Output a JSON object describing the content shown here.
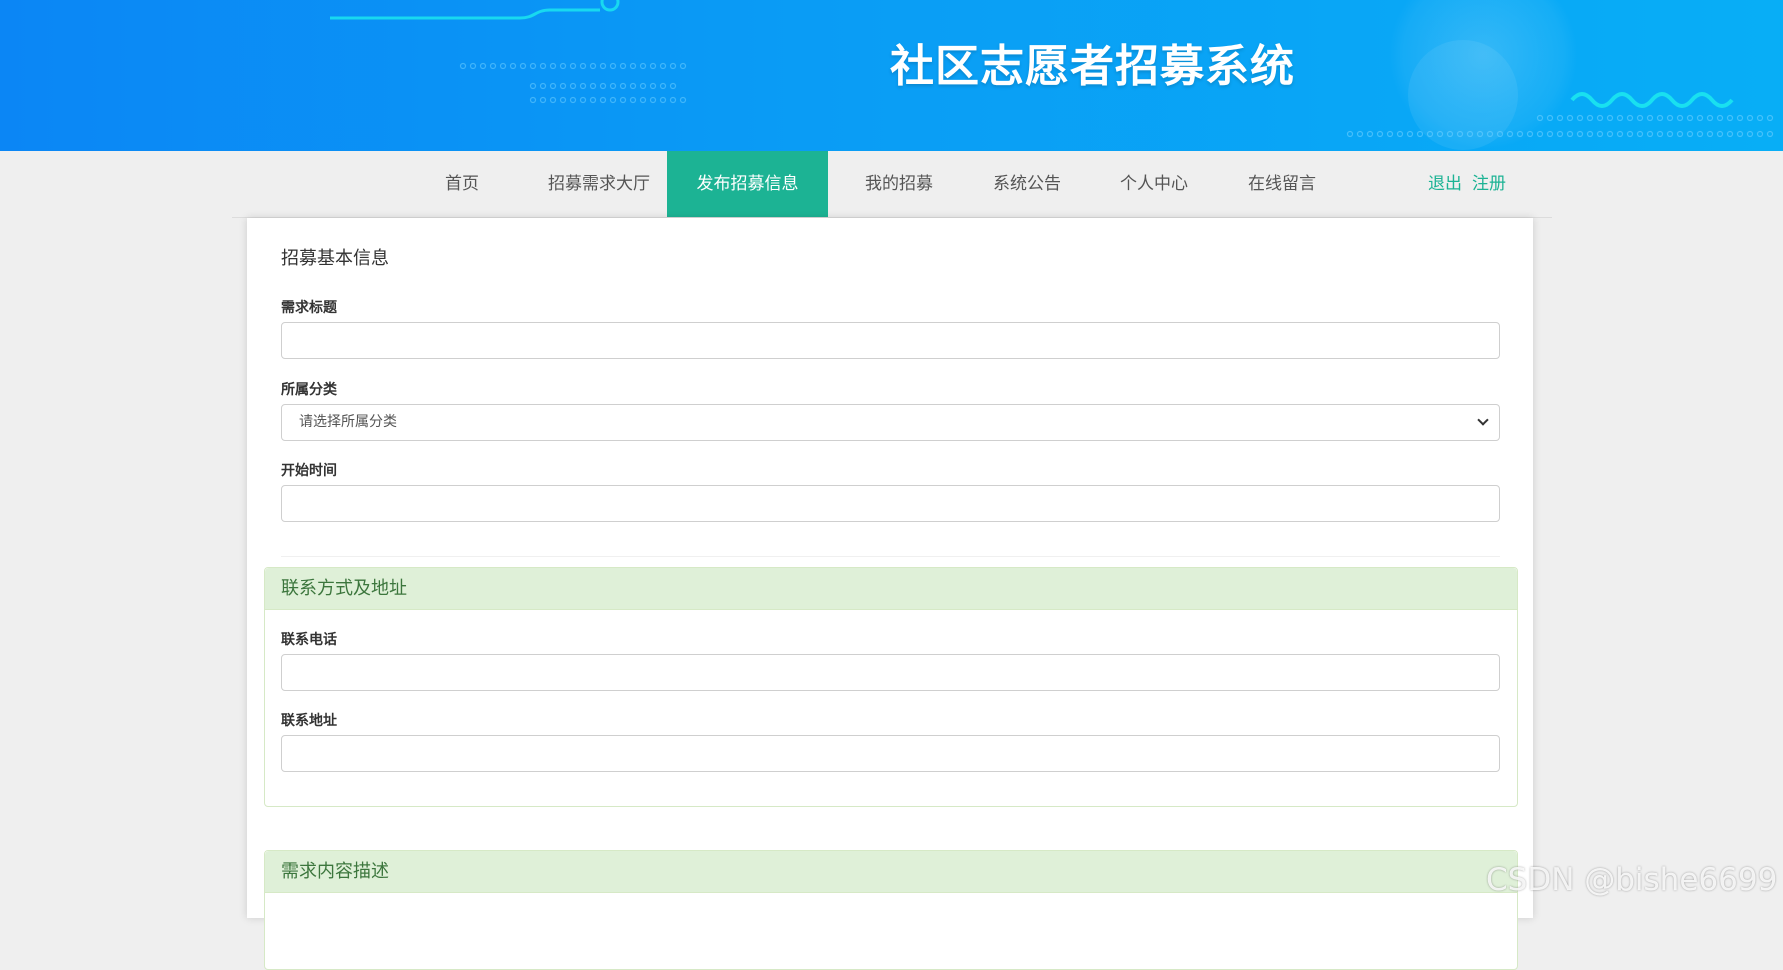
{
  "header": {
    "site_title": "社区志愿者招募系统"
  },
  "nav": {
    "items": [
      {
        "label": "首页",
        "active": false
      },
      {
        "label": "招募需求大厅",
        "active": false
      },
      {
        "label": "发布招募信息",
        "active": true
      },
      {
        "label": "我的招募",
        "active": false
      },
      {
        "label": "系统公告",
        "active": false
      },
      {
        "label": "个人中心",
        "active": false
      },
      {
        "label": "在线留言",
        "active": false
      }
    ],
    "logout_label": "退出",
    "register_label": "注册"
  },
  "form": {
    "basic_section_title": "招募基本信息",
    "title_label": "需求标题",
    "title_value": "",
    "category_label": "所属分类",
    "category_selected": "请选择所属分类",
    "start_time_label": "开始时间",
    "start_time_value": "",
    "contact_panel_title": "联系方式及地址",
    "phone_label": "联系电话",
    "phone_value": "",
    "address_label": "联系地址",
    "address_value": "",
    "description_panel_title": "需求内容描述"
  },
  "watermark": "CSDN @bishe6699",
  "colors": {
    "accent": "#1cb394",
    "banner": "#0a9cf5",
    "panel_head_bg": "#dff0d8",
    "panel_head_text": "#3c763d"
  }
}
